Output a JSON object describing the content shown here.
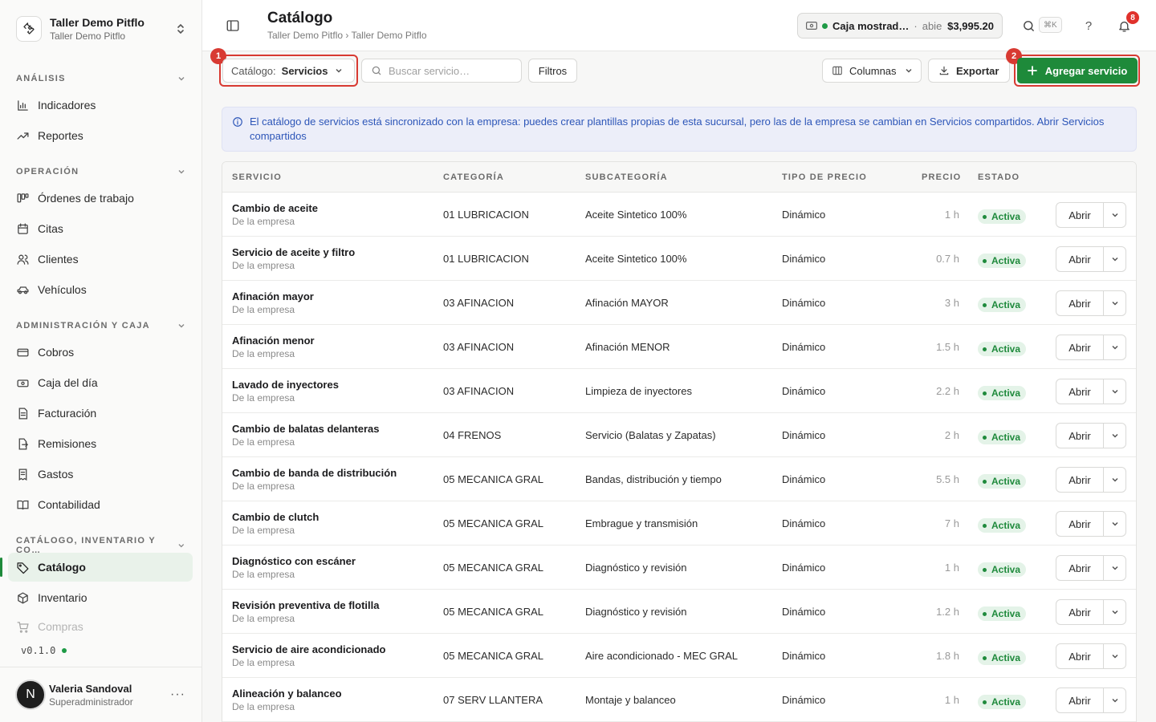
{
  "brand": {
    "name": "Taller Demo Pitflo",
    "sub": "Taller Demo Pitflo"
  },
  "sections": {
    "analisis": "ANÁLISIS",
    "operacion": "OPERACIÓN",
    "admin": "ADMINISTRACIÓN Y CAJA",
    "catalogo": "CATÁLOGO, INVENTARIO Y CO…"
  },
  "nav": {
    "indicadores": "Indicadores",
    "reportes": "Reportes",
    "ordenes": "Órdenes de trabajo",
    "citas": "Citas",
    "clientes": "Clientes",
    "vehiculos": "Vehículos",
    "cobros": "Cobros",
    "caja": "Caja del día",
    "facturacion": "Facturación",
    "remisiones": "Remisiones",
    "gastos": "Gastos",
    "contabilidad": "Contabilidad",
    "catalogo": "Catálogo",
    "inventario": "Inventario",
    "compras": "Compras"
  },
  "version": "v0.1.0",
  "user": {
    "initial": "N",
    "name": "Valeria Sandoval",
    "role": "Superadministrador",
    "more": "···"
  },
  "header": {
    "title": "Catálogo",
    "breadcrumb": "Taller Demo Pitflo › Taller Demo Pitflo",
    "cash_name": "Caja mostrad…",
    "cash_sep": "·",
    "cash_state": "abie",
    "cash_amount": "$3,995.20",
    "kbd": "⌘K",
    "help": "?",
    "notifications": "8"
  },
  "toolbar": {
    "catalog_label": "Catálogo:",
    "catalog_value": "Servicios",
    "search_placeholder": "Buscar servicio…",
    "filters": "Filtros",
    "columns": "Columnas",
    "export": "Exportar",
    "add": "Agregar servicio",
    "marker1": "1",
    "marker2": "2"
  },
  "banner": {
    "text": "El catálogo de servicios está sincronizado con la empresa: puedes crear plantillas propias de esta sucursal, pero las de la empresa se cambian en Servicios compartidos. Abrir Servicios compartidos"
  },
  "table": {
    "headers": [
      "SERVICIO",
      "CATEGORÍA",
      "SUBCATEGORÍA",
      "TIPO DE PRECIO",
      "PRECIO",
      "ESTADO"
    ],
    "open_label": "Abrir",
    "rows": [
      {
        "name": "Cambio de aceite",
        "source": "De la empresa",
        "category": "01 LUBRICACION",
        "subcategory": "Aceite Sintetico 100%",
        "price_type": "Dinámico",
        "price": "1 h",
        "status": "Activa"
      },
      {
        "name": "Servicio de aceite y filtro",
        "source": "De la empresa",
        "category": "01 LUBRICACION",
        "subcategory": "Aceite Sintetico 100%",
        "price_type": "Dinámico",
        "price": "0.7 h",
        "status": "Activa"
      },
      {
        "name": "Afinación mayor",
        "source": "De la empresa",
        "category": "03 AFINACION",
        "subcategory": "Afinación MAYOR",
        "price_type": "Dinámico",
        "price": "3 h",
        "status": "Activa"
      },
      {
        "name": "Afinación menor",
        "source": "De la empresa",
        "category": "03 AFINACION",
        "subcategory": "Afinación MENOR",
        "price_type": "Dinámico",
        "price": "1.5 h",
        "status": "Activa"
      },
      {
        "name": "Lavado de inyectores",
        "source": "De la empresa",
        "category": "03 AFINACION",
        "subcategory": "Limpieza de inyectores",
        "price_type": "Dinámico",
        "price": "2.2 h",
        "status": "Activa"
      },
      {
        "name": "Cambio de balatas delanteras",
        "source": "De la empresa",
        "category": "04 FRENOS",
        "subcategory": "Servicio (Balatas y Zapatas)",
        "price_type": "Dinámico",
        "price": "2 h",
        "status": "Activa"
      },
      {
        "name": "Cambio de banda de distribución",
        "source": "De la empresa",
        "category": "05 MECANICA GRAL",
        "subcategory": "Bandas, distribución y tiempo",
        "price_type": "Dinámico",
        "price": "5.5 h",
        "status": "Activa"
      },
      {
        "name": "Cambio de clutch",
        "source": "De la empresa",
        "category": "05 MECANICA GRAL",
        "subcategory": "Embrague y transmisión",
        "price_type": "Dinámico",
        "price": "7 h",
        "status": "Activa"
      },
      {
        "name": "Diagnóstico con escáner",
        "source": "De la empresa",
        "category": "05 MECANICA GRAL",
        "subcategory": "Diagnóstico y revisión",
        "price_type": "Dinámico",
        "price": "1 h",
        "status": "Activa"
      },
      {
        "name": "Revisión preventiva de flotilla",
        "source": "De la empresa",
        "category": "05 MECANICA GRAL",
        "subcategory": "Diagnóstico y revisión",
        "price_type": "Dinámico",
        "price": "1.2 h",
        "status": "Activa"
      },
      {
        "name": "Servicio de aire acondicionado",
        "source": "De la empresa",
        "category": "05 MECANICA GRAL",
        "subcategory": "Aire acondicionado - MEC GRAL",
        "price_type": "Dinámico",
        "price": "1.8 h",
        "status": "Activa"
      },
      {
        "name": "Alineación y balanceo",
        "source": "De la empresa",
        "category": "07 SERV LLANTERA",
        "subcategory": "Montaje y balanceo",
        "price_type": "Dinámico",
        "price": "1 h",
        "status": "Activa"
      }
    ]
  },
  "colors": {
    "accent": "#1e8a3a",
    "highlight": "#d83a32",
    "info": "#2d56b8"
  }
}
